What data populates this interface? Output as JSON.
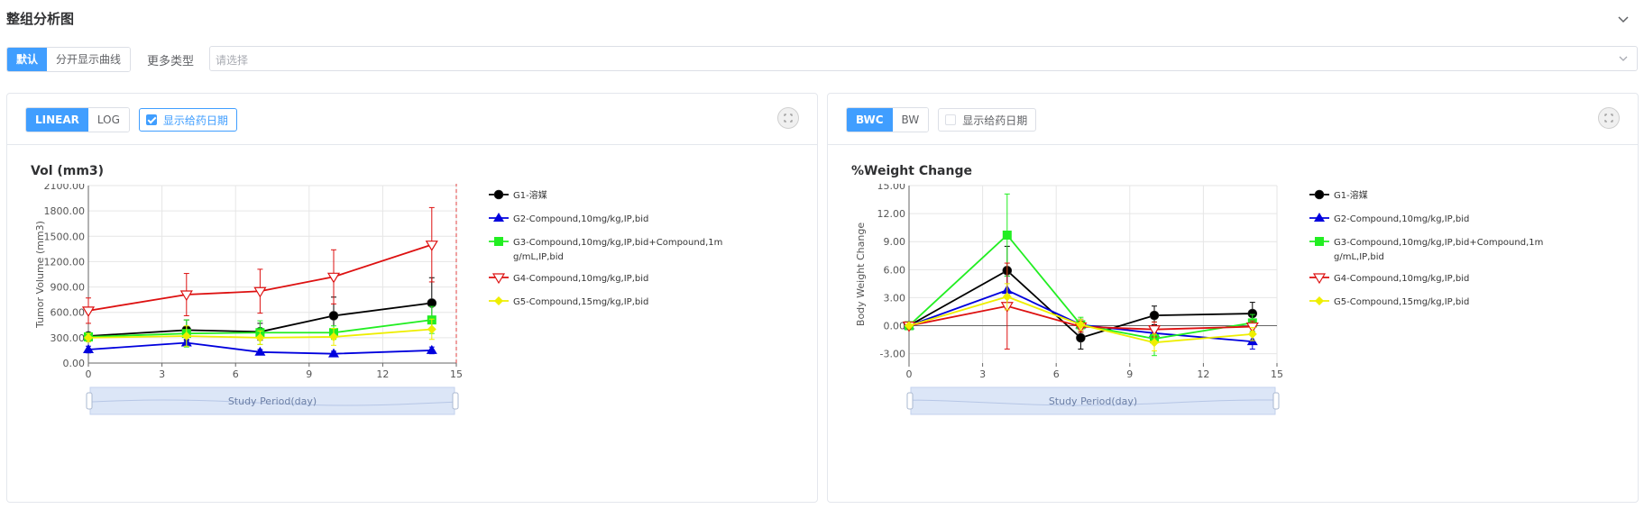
{
  "header": {
    "title": "整组分析图"
  },
  "toolbar": {
    "mode_default": "默认",
    "mode_split": "分开显示曲线",
    "more_types_label": "更多类型",
    "select_placeholder": "请选择"
  },
  "colors": {
    "accent": "#409eff",
    "G1": "#000000",
    "G2": "#0000dd",
    "G3": "#22ee22",
    "G4": "#dd1111",
    "G5": "#eeee00"
  },
  "legend": [
    {
      "id": "G1",
      "line1": "G1-溶媒",
      "line2": ""
    },
    {
      "id": "G2",
      "line1": "G2-Compound,10mg/kg,IP,bid",
      "line2": ""
    },
    {
      "id": "G3",
      "line1": "G3-Compound,10mg/kg,IP,bid+Compound,1m",
      "line2": "g/mL,IP,bid"
    },
    {
      "id": "G4",
      "line1": "G4-Compound,10mg/kg,IP,bid",
      "line2": ""
    },
    {
      "id": "G5",
      "line1": "G5-Compound,15mg/kg,IP,bid",
      "line2": ""
    }
  ],
  "left_panel": {
    "scale_linear": "LINEAR",
    "scale_log": "LOG",
    "show_dosing_label": "显示给药日期",
    "show_dosing_checked": true,
    "title": "Vol (mm3)"
  },
  "right_panel": {
    "mode_bwc": "BWC",
    "mode_bw": "BW",
    "show_dosing_label": "显示给药日期",
    "show_dosing_checked": false,
    "title": "%Weight Change"
  },
  "chart_data": [
    {
      "type": "line",
      "title": "Vol (mm3)",
      "xlabel": "Study Period(day)",
      "ylabel": "Tumor Volume (mm3)",
      "xlim": [
        0,
        15
      ],
      "ylim": [
        0,
        2100
      ],
      "xticks": [
        "0",
        "3",
        "6",
        "9",
        "12",
        "15"
      ],
      "yticks": [
        "0.00",
        "300.00",
        "600.00",
        "900.00",
        "1200.00",
        "1500.00",
        "1800.00",
        "2100.00"
      ],
      "dosing_day": 15,
      "grid": true,
      "legend_position": "right",
      "x": [
        0,
        4,
        7,
        10,
        14
      ],
      "series": [
        {
          "name": "G1-溶媒",
          "color": "#000000",
          "marker": "circle",
          "values": [
            320,
            390,
            370,
            560,
            710
          ],
          "err": [
            0,
            120,
            100,
            220,
            300
          ]
        },
        {
          "name": "G2-Compound,10mg/kg,IP,bid",
          "color": "#0000dd",
          "marker": "triangle",
          "values": [
            160,
            240,
            130,
            110,
            150
          ],
          "err": [
            40,
            40,
            30,
            30,
            40
          ]
        },
        {
          "name": "G3-Compound,10mg/kg,IP,bid+Compound,1mg/mL,IP,bid",
          "color": "#22ee22",
          "marker": "square",
          "values": [
            310,
            350,
            360,
            360,
            510
          ],
          "err": [
            40,
            160,
            140,
            80,
            160
          ]
        },
        {
          "name": "G4-Compound,10mg/kg,IP,bid",
          "color": "#dd1111",
          "marker": "triangle-down",
          "values": [
            620,
            810,
            850,
            1020,
            1400
          ],
          "err": [
            150,
            250,
            260,
            320,
            440
          ]
        },
        {
          "name": "G5-Compound,15mg/kg,IP,bid",
          "color": "#eeee00",
          "marker": "diamond",
          "values": [
            300,
            320,
            300,
            310,
            400
          ],
          "err": [
            50,
            120,
            80,
            100,
            120
          ]
        }
      ]
    },
    {
      "type": "line",
      "title": "%Weight Change",
      "xlabel": "Study Period(day)",
      "ylabel": "Body Weight Change",
      "xlim": [
        0,
        15
      ],
      "ylim": [
        -4,
        15
      ],
      "xticks": [
        "0",
        "3",
        "6",
        "9",
        "12",
        "15"
      ],
      "yticks": [
        "-3.00",
        "0.00",
        "3.00",
        "6.00",
        "9.00",
        "12.00",
        "15.00"
      ],
      "grid": true,
      "legend_position": "right",
      "x": [
        0,
        4,
        7,
        10,
        14
      ],
      "series": [
        {
          "name": "G1-溶媒",
          "color": "#000000",
          "marker": "circle",
          "values": [
            0,
            5.9,
            -1.3,
            1.1,
            1.3
          ],
          "err": [
            0,
            2.6,
            1.2,
            1.0,
            1.2
          ]
        },
        {
          "name": "G2-Compound,10mg/kg,IP,bid",
          "color": "#0000dd",
          "marker": "triangle",
          "values": [
            0,
            3.8,
            0.1,
            -0.8,
            -1.7
          ],
          "err": [
            0,
            1.5,
            0.6,
            0.7,
            0.8
          ]
        },
        {
          "name": "G3-Compound,10mg/kg,IP,bid+Compound,1mg/mL,IP,bid",
          "color": "#22ee22",
          "marker": "square",
          "values": [
            0,
            9.7,
            0.1,
            -1.4,
            0.3
          ],
          "err": [
            0,
            4.4,
            0.8,
            1.8,
            0.9
          ]
        },
        {
          "name": "G4-Compound,10mg/kg,IP,bid",
          "color": "#dd1111",
          "marker": "triangle-down",
          "values": [
            0,
            2.1,
            -0.1,
            -0.4,
            -0.1
          ],
          "err": [
            0,
            4.6,
            0.6,
            0.8,
            0.6
          ]
        },
        {
          "name": "G5-Compound,15mg/kg,IP,bid",
          "color": "#eeee00",
          "marker": "diamond",
          "values": [
            0,
            3.1,
            0.1,
            -1.8,
            -0.9
          ],
          "err": [
            0,
            1.4,
            0.6,
            0.9,
            0.7
          ]
        }
      ]
    }
  ]
}
